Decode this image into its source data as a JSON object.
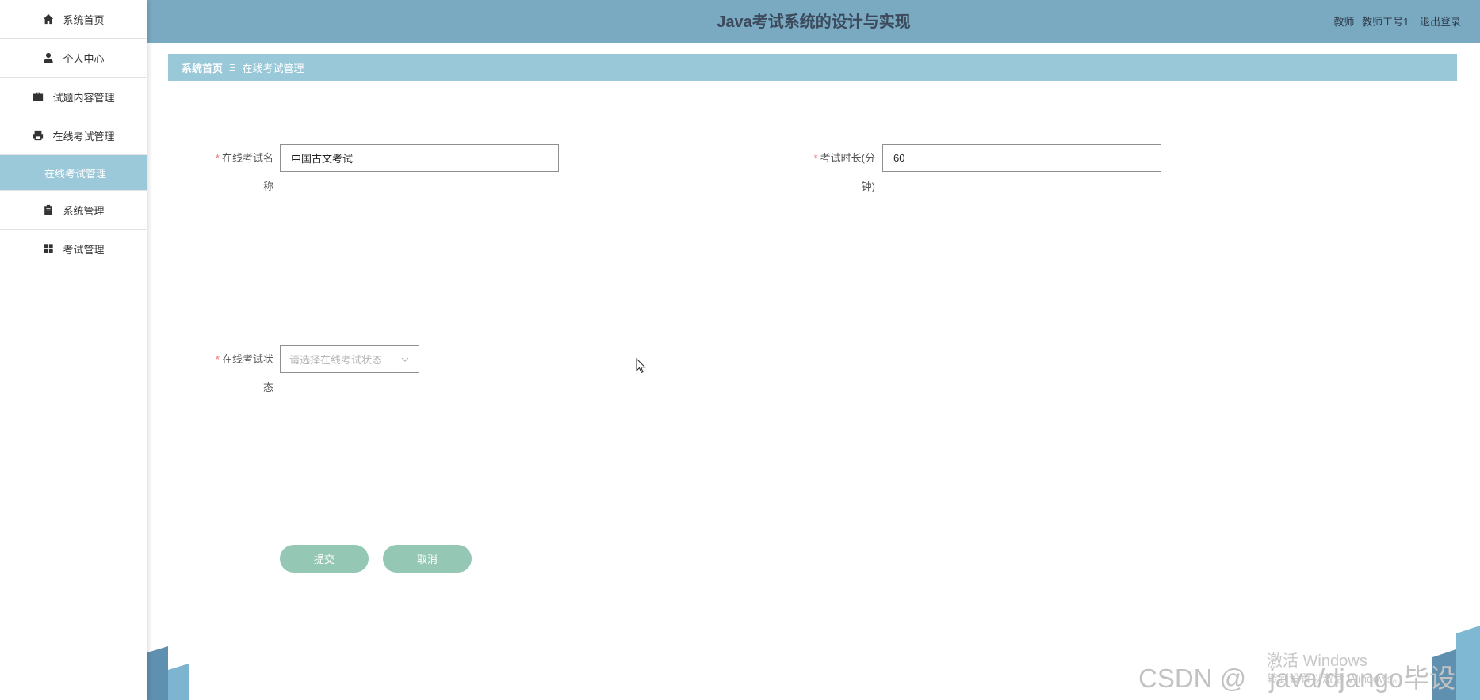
{
  "header": {
    "title": "Java考试系统的设计与实现",
    "role": "教师",
    "username": "教师工号1",
    "logout": "退出登录"
  },
  "sidebar": {
    "items": [
      {
        "label": "系统首页",
        "icon": "home-icon"
      },
      {
        "label": "个人中心",
        "icon": "user-icon"
      },
      {
        "label": "试题内容管理",
        "icon": "briefcase-icon"
      },
      {
        "label": "在线考试管理",
        "icon": "printer-icon"
      }
    ],
    "active_sub": "在线考试管理",
    "items_after": [
      {
        "label": "系统管理",
        "icon": "clipboard-icon"
      },
      {
        "label": "考试管理",
        "icon": "grid-icon"
      }
    ]
  },
  "breadcrumb": {
    "home": "系统首页",
    "separator": "Ξ",
    "current": "在线考试管理"
  },
  "form": {
    "required_mark": "*",
    "name_label_line1": "在线考试名",
    "name_label_line2": "称",
    "name_value": "中国古文考试",
    "duration_label_line1": "考试时长(分",
    "duration_label_line2": "钟)",
    "duration_value": "60",
    "status_label_line1": "在线考试状",
    "status_label_line2": "态",
    "status_placeholder": "请选择在线考试状态"
  },
  "buttons": {
    "submit": "提交",
    "cancel": "取消"
  },
  "watermarks": {
    "csdn": "CSDN @",
    "activate_line1": "激活 Windows",
    "activate_line2": "转到设置以激活 Windows。",
    "author": "java/django毕设"
  },
  "colors": {
    "header_bg": "#79aac2",
    "breadcrumb_bg": "#99c8d8",
    "active_sub_bg": "#9cc9d9",
    "button_bg": "#95c7b5",
    "required": "#f56c6c"
  }
}
